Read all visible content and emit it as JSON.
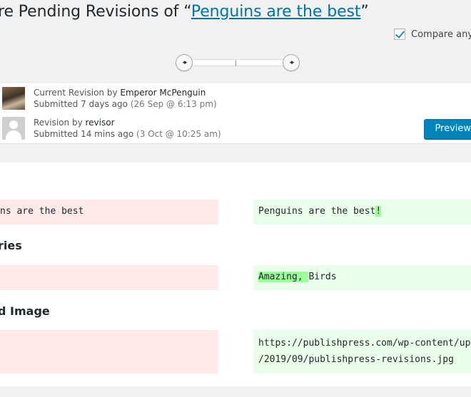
{
  "header": {
    "title_prefix": "re Pending Revisions of “",
    "title_link": "Penguins are the best",
    "title_suffix": "”"
  },
  "compare_any": {
    "label": "Compare any t",
    "checked": true
  },
  "slider": {
    "left_handle": "◂▸",
    "right_handle": "◂▸"
  },
  "revisions": {
    "current": {
      "prefix": "Current Revision by ",
      "author": "Emperor McPenguin",
      "submitted": "Submitted 7 days ago",
      "date": "(26 Sep @ 6:13 pm)"
    },
    "pending": {
      "prefix": "Revision by ",
      "author": "revisor",
      "submitted": "Submitted 14 mins ago",
      "date": "(3 Oct @ 10:25 am)"
    },
    "preview_button": "Preview / "
  },
  "diff": {
    "title_row": {
      "old": "ns are the best",
      "new_base": "Penguins are the best",
      "new_added": "!"
    },
    "categories": {
      "label": "ries",
      "old": "",
      "new_added": "Amazing, ",
      "new_base": "Birds"
    },
    "featured_image": {
      "label": "d Image",
      "old": "",
      "new_line1": "https://publishpress.com/wp-content/up",
      "new_line2": "/2019/09/publishpress-revisions.jpg"
    }
  }
}
